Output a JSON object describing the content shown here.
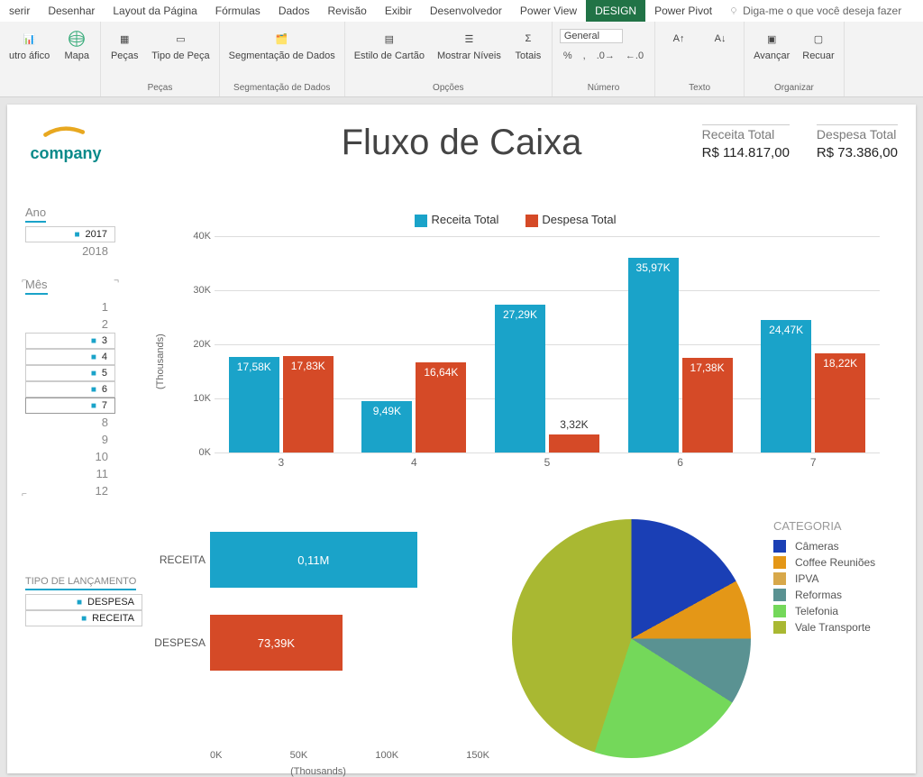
{
  "tabs": [
    "serir",
    "Desenhar",
    "Layout da Página",
    "Fórmulas",
    "Dados",
    "Revisão",
    "Exibir",
    "Desenvolvedor",
    "Power View",
    "DESIGN",
    "Power Pivot"
  ],
  "active_tab": "DESIGN",
  "tellme": "Diga-me o que você deseja fazer",
  "ribbon": {
    "g1": {
      "btn1": "utro\náfico",
      "btn2": "Mapa",
      "label": ""
    },
    "g2": {
      "btn1": "Peças",
      "btn2": "Tipo de\nPeça",
      "label": "Peças"
    },
    "g3": {
      "btn1": "Segmentação\nde Dados",
      "label": "Segmentação de Dados"
    },
    "g4": {
      "btn1": "Estilo de\nCartão",
      "btn2": "Mostrar\nNíveis",
      "btn3": "Totais",
      "label": "Opções"
    },
    "g5": {
      "format": "General",
      "label": "Número"
    },
    "g6": {
      "label": "Texto"
    },
    "g7": {
      "btn1": "Avançar",
      "btn2": "Recuar",
      "label": "Organizar"
    }
  },
  "logo_text": "company",
  "title": "Fluxo de Caixa",
  "kpi": {
    "receita_l": "Receita Total",
    "receita_v": "R$ 114.817,00",
    "despesa_l": "Despesa Total",
    "despesa_v": "R$ 73.386,00"
  },
  "slicer_ano": {
    "hd": "Ano",
    "items": [
      {
        "t": "2017",
        "sel": true
      },
      {
        "t": "2018",
        "sel": false
      }
    ]
  },
  "slicer_mes": {
    "hd": "Mês",
    "items": [
      {
        "t": "1"
      },
      {
        "t": "2"
      },
      {
        "t": "3",
        "sel": true
      },
      {
        "t": "4",
        "sel": true
      },
      {
        "t": "5",
        "sel": true
      },
      {
        "t": "6",
        "sel": true
      },
      {
        "t": "7",
        "sel": true,
        "last": true
      },
      {
        "t": "8"
      },
      {
        "t": "9"
      },
      {
        "t": "10"
      },
      {
        "t": "11"
      },
      {
        "t": "12"
      }
    ]
  },
  "slicer_tipo": {
    "hd": "TIPO DE LANÇAMENTO",
    "items": [
      {
        "t": "DESPESA",
        "sel": true
      },
      {
        "t": "RECEITA",
        "sel": true
      }
    ]
  },
  "legend": {
    "a": "Receita Total",
    "b": "Despesa Total"
  },
  "chart_data": {
    "type": "bar",
    "title": "",
    "xlabel": "",
    "ylabel": "(Thousands)",
    "ylim": [
      0,
      40
    ],
    "yticks": [
      "0K",
      "10K",
      "20K",
      "30K",
      "40K"
    ],
    "categories": [
      "3",
      "4",
      "5",
      "6",
      "7"
    ],
    "series": [
      {
        "name": "Receita Total",
        "color": "#1aa3c9",
        "values": [
          17.58,
          9.49,
          27.29,
          35.97,
          24.47
        ],
        "labels": [
          "17,58K",
          "9,49K",
          "27,29K",
          "35,97K",
          "24,47K"
        ]
      },
      {
        "name": "Despesa Total",
        "color": "#d54a27",
        "values": [
          17.83,
          16.64,
          3.32,
          17.38,
          18.22
        ],
        "labels": [
          "17,83K",
          "16,64K",
          "3,32K",
          "17,38K",
          "18,22K"
        ]
      }
    ]
  },
  "hbar": {
    "type": "bar",
    "orientation": "horizontal",
    "ylabel": "(Thousands)",
    "xticks": [
      "0K",
      "50K",
      "100K",
      "150K"
    ],
    "xlim": [
      0,
      150
    ],
    "rows": [
      {
        "cat": "RECEITA",
        "v": 114.82,
        "label": "0,11M",
        "color": "#1aa3c9"
      },
      {
        "cat": "DESPESA",
        "v": 73.39,
        "label": "73,39K",
        "color": "#d54a27"
      }
    ]
  },
  "pie": {
    "title": "CATEGORIA",
    "items": [
      {
        "name": "Câmeras",
        "color": "#1a3fb5"
      },
      {
        "name": "Coffee Reuniões",
        "color": "#e49717"
      },
      {
        "name": "IPVA",
        "color": "#d8a84a"
      },
      {
        "name": "Reformas",
        "color": "#5a9292"
      },
      {
        "name": "Telefonia",
        "color": "#74d85a"
      },
      {
        "name": "Vale Transporte",
        "color": "#a9b832"
      }
    ]
  }
}
